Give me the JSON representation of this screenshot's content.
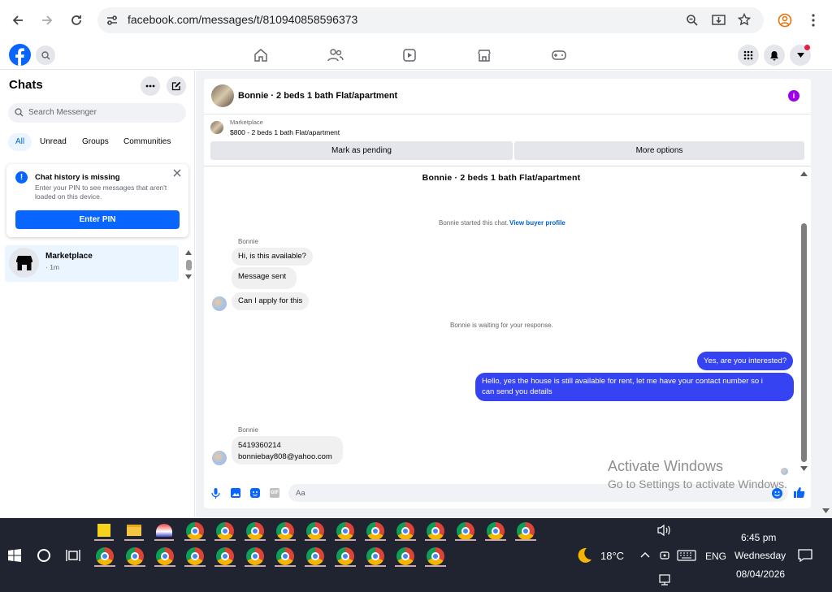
{
  "browser": {
    "url": "facebook.com/messages/t/810940858596373"
  },
  "sidebar": {
    "title": "Chats",
    "search_placeholder": "Search Messenger",
    "filters": [
      "All",
      "Unread",
      "Groups",
      "Communities"
    ],
    "alert": {
      "title": "Chat history is missing",
      "body_line1": "Enter your PIN to see messages that aren't",
      "body_line2": "loaded on this device.",
      "button": "Enter PIN"
    },
    "conversation": {
      "name": "Marketplace",
      "time": "· 1m"
    }
  },
  "thread": {
    "header_title": "Bonnie · 2 beds 1 bath Flat/apartment",
    "listing_source": "Marketplace",
    "listing_price": "$800 - 2 beds 1 bath Flat/apartment",
    "buttons": {
      "mark_pending": "Mark as pending",
      "more_options": "More options"
    },
    "intro_title": "Bonnie · 2 beds 1 bath Flat/apartment",
    "started_text": "Bonnie started this chat.",
    "view_profile": "View buyer profile",
    "sender1": "Bonnie",
    "msg1": "Hi, is this available?",
    "msg2": "Message sent",
    "msg3": "Can I apply for this",
    "waiting": "Bonnie is waiting for your response.",
    "out1": "Yes, are you interested?",
    "out2_line1": "Hello, yes the house is still available for rent, let me have your contact number so i",
    "out2_line2": "can send you details",
    "sender2": "Bonnie",
    "msg4_line1": "5419360214",
    "msg4_line2": "bonniebay808@yahoo.com",
    "composer_placeholder": "Aa"
  },
  "watermark": {
    "line1": "Activate Windows",
    "line2": "Go to Settings to activate Windows."
  },
  "taskbar": {
    "weather": "18°C",
    "lang": "ENG",
    "time": "6:45 pm",
    "day": "Wednesday",
    "date": "08/04/2026"
  },
  "colors": {
    "fb_blue": "#0866ff",
    "outgoing": "#3543f2",
    "taskbar": "#1f2430"
  }
}
